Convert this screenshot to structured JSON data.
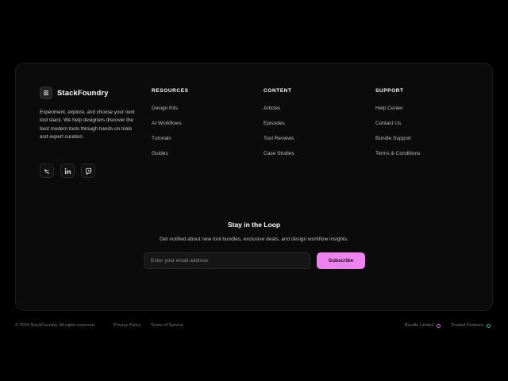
{
  "brand": {
    "name": "StackFoundry",
    "description": "Experiment, explore, and choose your next tool stack. We help designers discover the best modern tools through hands-on trials and expert curation."
  },
  "socials": [
    {
      "name": "twitter-icon",
      "label": "Twitter"
    },
    {
      "name": "linkedin-icon",
      "label": "LinkedIn"
    },
    {
      "name": "twitch-icon",
      "label": "Twitch"
    }
  ],
  "columns": {
    "resources": {
      "heading": "RESOURCES",
      "items": [
        "Design Kits",
        "AI Workflows",
        "Tutorials",
        "Guides"
      ]
    },
    "content": {
      "heading": "CONTENT",
      "items": [
        "Articles",
        "Episodes",
        "Tool Reviews",
        "Case Studies"
      ]
    },
    "support": {
      "heading": "SUPPORT",
      "items": [
        "Help Center",
        "Contact Us",
        "Bundle Support",
        "Terms & Conditions"
      ]
    }
  },
  "newsletter": {
    "title": "Stay in the Loop",
    "subtitle": "Get notified about new tool bundles, exclusive deals, and design workflow insights.",
    "placeholder": "Enter your email address",
    "button_label": "Subscribe"
  },
  "footer_bottom": {
    "copyright": "© 2024 StackFoundry. All rights reserved.",
    "privacy": "Privacy Policy",
    "terms": "Terms of Service",
    "badge1": "Bundle Limited",
    "badge2": "Trusted Partners",
    "badge1_color": "#e06ee0",
    "badge2_color": "#3fb96e"
  },
  "colors": {
    "accent": "#ee82ee",
    "background": "#000000",
    "card": "#0b0b0b"
  }
}
